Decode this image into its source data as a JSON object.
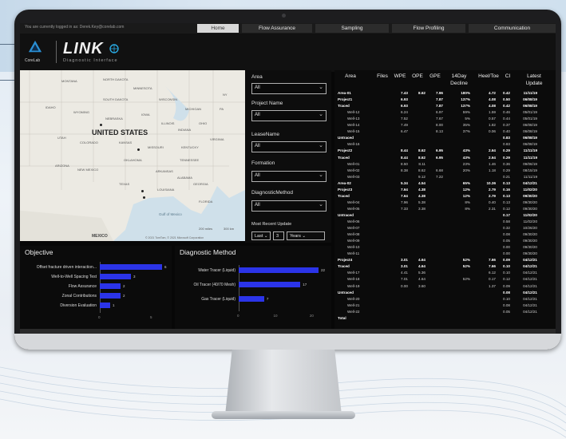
{
  "topbar": {
    "login_text": "You are currently logged in as: Derek.Key@corelab.com",
    "tabs": [
      {
        "label": "Home",
        "active": true
      },
      {
        "label": "Flow Assurance",
        "active": false
      },
      {
        "label": "Sampling",
        "active": false
      },
      {
        "label": "Flow Profiling",
        "active": false
      },
      {
        "label": "Communication",
        "active": false
      }
    ]
  },
  "header": {
    "company": "CoreLab",
    "product": "LINK",
    "subtitle": "Diagnostic Interface"
  },
  "map": {
    "country_main": "UNITED STATES",
    "country_south": "MEXICO",
    "gulf": "Gulf of Mexico",
    "states": [
      "MONTANA",
      "NORTH DAKOTA",
      "MINNESOTA",
      "SOUTH DAKOTA",
      "WISCONSIN",
      "IDAHO",
      "WYOMING",
      "IOWA",
      "MICHIGAN",
      "NEBRASKA",
      "ILLINOIS",
      "INDIANA",
      "OHIO",
      "UTAH",
      "COLORADO",
      "KANSAS",
      "MISSOURI",
      "KENTUCKY",
      "VIRGINIA",
      "ARIZONA",
      "NEW MEXICO",
      "OKLAHOMA",
      "TENNESSEE",
      "ARKANSAS",
      "TEXAS",
      "LOUISIANA",
      "ALABAMA",
      "GEORGIA",
      "FLORIDA",
      "PA",
      "NY"
    ],
    "scale": "200 miles",
    "scale2": "300 km",
    "copyright": "© 2021 TomTom, © 2021 Microsoft Corporation"
  },
  "filters": {
    "items": [
      {
        "label": "Area",
        "value": "All"
      },
      {
        "label": "Project Name",
        "value": "All"
      },
      {
        "label": "LeaseName",
        "value": "All"
      },
      {
        "label": "Formation",
        "value": "All"
      },
      {
        "label": "DiagnosticMethod",
        "value": "All"
      }
    ],
    "recent_label": "Most Recent Update",
    "recent_mode": "Last",
    "recent_count": "3",
    "recent_unit": "Years"
  },
  "table": {
    "headers": [
      "Area",
      "Files",
      "WPE",
      "OPE",
      "GPE",
      "14Day Decline",
      "Heel/Toe",
      "CI",
      "Latest Update"
    ],
    "rows": [
      {
        "area": "Area-01",
        "files": "",
        "wpe": "7.43",
        "ope": "8.62",
        "gpe": "7.96",
        "dec": "180%",
        "ht": "4.72",
        "ci": "0.42",
        "upd": "11/11/19",
        "bold": true
      },
      {
        "area": "Project1",
        "files": "",
        "wpe": "6.93",
        "ope": "",
        "gpe": "7.87",
        "dec": "137%",
        "ht": "4.08",
        "ci": "0.50",
        "upd": "06/08/19",
        "bold": true
      },
      {
        "area": "Traced",
        "files": "",
        "wpe": "6.93",
        "ope": "",
        "gpe": "7.87",
        "dec": "137%",
        "ht": "4.08",
        "ci": "0.42",
        "upd": "06/08/19",
        "bold": true
      },
      {
        "area": "Well-12",
        "files": "",
        "wpe": "6.24",
        "ope": "",
        "gpe": "6.97",
        "dec": "59%",
        "ht": "1.59",
        "ci": "0.46",
        "upd": "05/01/19",
        "bold": false
      },
      {
        "area": "Well-13",
        "files": "",
        "wpe": "7.52",
        "ope": "",
        "gpe": "7.67",
        "dec": "5%",
        "ht": "0.57",
        "ci": "0.44",
        "upd": "05/01/19",
        "bold": false
      },
      {
        "area": "Well-14",
        "files": "",
        "wpe": "7.49",
        "ope": "",
        "gpe": "8.00",
        "dec": "35%",
        "ht": "1.82",
        "ci": "0.37",
        "upd": "06/08/19",
        "bold": false
      },
      {
        "area": "Well-15",
        "files": "",
        "wpe": "6.47",
        "ope": "",
        "gpe": "8.13",
        "dec": "37%",
        "ht": "0.06",
        "ci": "0.40",
        "upd": "06/08/19",
        "bold": false
      },
      {
        "area": "Untraced",
        "files": "",
        "wpe": "",
        "ope": "",
        "gpe": "",
        "dec": "",
        "ht": "",
        "ci": "0.83",
        "upd": "06/08/19",
        "bold": true
      },
      {
        "area": "Well-16",
        "files": "",
        "wpe": "",
        "ope": "",
        "gpe": "",
        "dec": "",
        "ht": "",
        "ci": "0.83",
        "upd": "06/08/19",
        "bold": false
      },
      {
        "area": "Project2",
        "files": "",
        "wpe": "8.44",
        "ope": "8.62",
        "gpe": "6.95",
        "dec": "43%",
        "ht": "2.64",
        "ci": "0.29",
        "upd": "11/11/19",
        "bold": true
      },
      {
        "area": "Traced",
        "files": "",
        "wpe": "8.44",
        "ope": "8.62",
        "gpe": "6.95",
        "dec": "43%",
        "ht": "2.64",
        "ci": "0.29",
        "upd": "11/11/19",
        "bold": true
      },
      {
        "area": "Well-01",
        "files": "",
        "wpe": "8.50",
        "ope": "8.11",
        "gpe": "",
        "dec": "23%",
        "ht": "1.46",
        "ci": "0.36",
        "upd": "09/06/19",
        "bold": false
      },
      {
        "area": "Well-02",
        "files": "",
        "wpe": "8.38",
        "ope": "8.62",
        "gpe": "6.68",
        "dec": "20%",
        "ht": "1.18",
        "ci": "0.29",
        "upd": "08/15/19",
        "bold": false
      },
      {
        "area": "Well-03",
        "files": "",
        "wpe": "",
        "ope": "9.12",
        "gpe": "7.22",
        "dec": "",
        "ht": "",
        "ci": "0.21",
        "upd": "11/11/19",
        "bold": false
      },
      {
        "area": "Area-02",
        "files": "",
        "wpe": "5.34",
        "ope": "4.54",
        "gpe": "",
        "dec": "65%",
        "ht": "10.36",
        "ci": "0.13",
        "upd": "04/12/21",
        "bold": true
      },
      {
        "area": "Project3",
        "files": "",
        "wpe": "7.64",
        "ope": "4.38",
        "gpe": "",
        "dec": "12%",
        "ht": "2.79",
        "ci": "0.16",
        "upd": "11/02/20",
        "bold": true
      },
      {
        "area": "Traced",
        "files": "",
        "wpe": "7.64",
        "ope": "4.38",
        "gpe": "",
        "dec": "12%",
        "ht": "2.79",
        "ci": "0.13",
        "upd": "09/30/20",
        "bold": true
      },
      {
        "area": "Well-04",
        "files": "",
        "wpe": "7.96",
        "ope": "5.38",
        "gpe": "",
        "dec": "8%",
        "ht": "0.40",
        "ci": "0.13",
        "upd": "09/30/20",
        "bold": false
      },
      {
        "area": "Well-05",
        "files": "",
        "wpe": "7.33",
        "ope": "3.38",
        "gpe": "",
        "dec": "8%",
        "ht": "2.31",
        "ci": "0.12",
        "upd": "09/30/20",
        "bold": false
      },
      {
        "area": "Untraced",
        "files": "",
        "wpe": "",
        "ope": "",
        "gpe": "",
        "dec": "",
        "ht": "",
        "ci": "0.17",
        "upd": "11/02/20",
        "bold": true
      },
      {
        "area": "Well-06",
        "files": "",
        "wpe": "",
        "ope": "",
        "gpe": "",
        "dec": "",
        "ht": "",
        "ci": "0.58",
        "upd": "11/02/20",
        "bold": false
      },
      {
        "area": "Well-07",
        "files": "",
        "wpe": "",
        "ope": "",
        "gpe": "",
        "dec": "",
        "ht": "",
        "ci": "0.32",
        "upd": "10/26/20",
        "bold": false
      },
      {
        "area": "Well-08",
        "files": "",
        "wpe": "",
        "ope": "",
        "gpe": "",
        "dec": "",
        "ht": "",
        "ci": "0.08",
        "upd": "09/30/20",
        "bold": false
      },
      {
        "area": "Well-09",
        "files": "",
        "wpe": "",
        "ope": "",
        "gpe": "",
        "dec": "",
        "ht": "",
        "ci": "0.05",
        "upd": "09/30/20",
        "bold": false
      },
      {
        "area": "Well-10",
        "files": "",
        "wpe": "",
        "ope": "",
        "gpe": "",
        "dec": "",
        "ht": "",
        "ci": "0.00",
        "upd": "09/30/20",
        "bold": false
      },
      {
        "area": "Well-11",
        "files": "",
        "wpe": "",
        "ope": "",
        "gpe": "",
        "dec": "",
        "ht": "",
        "ci": "0.00",
        "upd": "09/30/20",
        "bold": false
      },
      {
        "area": "Project4",
        "files": "",
        "wpe": "3.01",
        "ope": "4.64",
        "gpe": "",
        "dec": "52%",
        "ht": "7.66",
        "ci": "0.09",
        "upd": "04/12/21",
        "bold": true
      },
      {
        "area": "Traced",
        "files": "",
        "wpe": "3.01",
        "ope": "4.64",
        "gpe": "",
        "dec": "52%",
        "ht": "7.66",
        "ci": "0.10",
        "upd": "04/12/21",
        "bold": true
      },
      {
        "area": "Well-17",
        "files": "",
        "wpe": "4.41",
        "ope": "5.36",
        "gpe": "",
        "dec": "",
        "ht": "6.12",
        "ci": "0.10",
        "upd": "04/12/21",
        "bold": false
      },
      {
        "area": "Well-18",
        "files": "",
        "wpe": "7.01",
        "ope": "4.64",
        "gpe": "",
        "dec": "52%",
        "ht": "0.17",
        "ci": "0.12",
        "upd": "04/12/21",
        "bold": false
      },
      {
        "area": "Well-19",
        "files": "",
        "wpe": "0.00",
        "ope": "3.60",
        "gpe": "",
        "dec": "",
        "ht": "1.37",
        "ci": "0.09",
        "upd": "04/12/21",
        "bold": false
      },
      {
        "area": "Untraced",
        "files": "",
        "wpe": "",
        "ope": "",
        "gpe": "",
        "dec": "",
        "ht": "",
        "ci": "0.08",
        "upd": "04/12/21",
        "bold": true
      },
      {
        "area": "Well-20",
        "files": "",
        "wpe": "",
        "ope": "",
        "gpe": "",
        "dec": "",
        "ht": "",
        "ci": "0.10",
        "upd": "04/12/21",
        "bold": false
      },
      {
        "area": "Well-21",
        "files": "",
        "wpe": "",
        "ope": "",
        "gpe": "",
        "dec": "",
        "ht": "",
        "ci": "0.08",
        "upd": "04/12/21",
        "bold": false
      },
      {
        "area": "Well-22",
        "files": "",
        "wpe": "",
        "ope": "",
        "gpe": "",
        "dec": "",
        "ht": "",
        "ci": "0.05",
        "upd": "04/12/21",
        "bold": false
      },
      {
        "area": "Total",
        "files": "",
        "wpe": "",
        "ope": "",
        "gpe": "",
        "dec": "",
        "ht": "",
        "ci": "",
        "upd": "",
        "bold": true
      }
    ]
  },
  "objective": {
    "title": "Objective",
    "bars": [
      {
        "label": "Offset fracture driven interaction...",
        "value": 6
      },
      {
        "label": "Well-to-Well Spacing Test",
        "value": 3
      },
      {
        "label": "Flow Assurance",
        "value": 2
      },
      {
        "label": "Zonal Contributions",
        "value": 2
      },
      {
        "label": "Diversion Evaluation",
        "value": 1
      }
    ],
    "max": 6,
    "ticks": [
      "0",
      "5"
    ]
  },
  "diagnostic": {
    "title": "Diagnostic Method",
    "bars": [
      {
        "label": "Water Tracer (Liquid)",
        "value": 22
      },
      {
        "label": "Oil Tracer (40/70 Mesh)",
        "value": 17
      },
      {
        "label": "Gas Tracer (Liquid)",
        "value": 7
      }
    ],
    "max": 22,
    "ticks": [
      "0",
      "10",
      "20"
    ]
  },
  "colors": {
    "bar": "#2b34e8",
    "background": "#070707",
    "accent": "#29a8e0"
  }
}
